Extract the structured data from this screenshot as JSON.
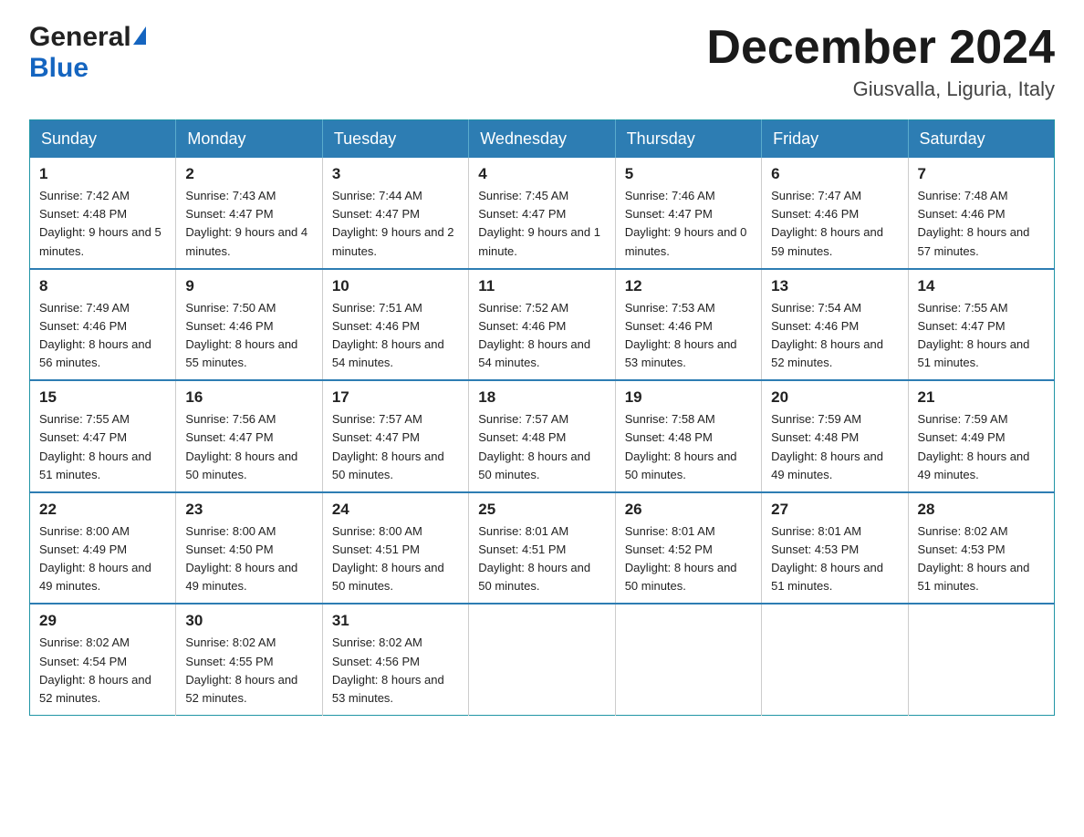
{
  "header": {
    "logo_general": "General",
    "logo_blue": "Blue",
    "month_title": "December 2024",
    "location": "Giusvalla, Liguria, Italy"
  },
  "days_of_week": [
    "Sunday",
    "Monday",
    "Tuesday",
    "Wednesday",
    "Thursday",
    "Friday",
    "Saturday"
  ],
  "weeks": [
    [
      {
        "day": "1",
        "sunrise": "7:42 AM",
        "sunset": "4:48 PM",
        "daylight": "9 hours and 5 minutes."
      },
      {
        "day": "2",
        "sunrise": "7:43 AM",
        "sunset": "4:47 PM",
        "daylight": "9 hours and 4 minutes."
      },
      {
        "day": "3",
        "sunrise": "7:44 AM",
        "sunset": "4:47 PM",
        "daylight": "9 hours and 2 minutes."
      },
      {
        "day": "4",
        "sunrise": "7:45 AM",
        "sunset": "4:47 PM",
        "daylight": "9 hours and 1 minute."
      },
      {
        "day": "5",
        "sunrise": "7:46 AM",
        "sunset": "4:47 PM",
        "daylight": "9 hours and 0 minutes."
      },
      {
        "day": "6",
        "sunrise": "7:47 AM",
        "sunset": "4:46 PM",
        "daylight": "8 hours and 59 minutes."
      },
      {
        "day": "7",
        "sunrise": "7:48 AM",
        "sunset": "4:46 PM",
        "daylight": "8 hours and 57 minutes."
      }
    ],
    [
      {
        "day": "8",
        "sunrise": "7:49 AM",
        "sunset": "4:46 PM",
        "daylight": "8 hours and 56 minutes."
      },
      {
        "day": "9",
        "sunrise": "7:50 AM",
        "sunset": "4:46 PM",
        "daylight": "8 hours and 55 minutes."
      },
      {
        "day": "10",
        "sunrise": "7:51 AM",
        "sunset": "4:46 PM",
        "daylight": "8 hours and 54 minutes."
      },
      {
        "day": "11",
        "sunrise": "7:52 AM",
        "sunset": "4:46 PM",
        "daylight": "8 hours and 54 minutes."
      },
      {
        "day": "12",
        "sunrise": "7:53 AM",
        "sunset": "4:46 PM",
        "daylight": "8 hours and 53 minutes."
      },
      {
        "day": "13",
        "sunrise": "7:54 AM",
        "sunset": "4:46 PM",
        "daylight": "8 hours and 52 minutes."
      },
      {
        "day": "14",
        "sunrise": "7:55 AM",
        "sunset": "4:47 PM",
        "daylight": "8 hours and 51 minutes."
      }
    ],
    [
      {
        "day": "15",
        "sunrise": "7:55 AM",
        "sunset": "4:47 PM",
        "daylight": "8 hours and 51 minutes."
      },
      {
        "day": "16",
        "sunrise": "7:56 AM",
        "sunset": "4:47 PM",
        "daylight": "8 hours and 50 minutes."
      },
      {
        "day": "17",
        "sunrise": "7:57 AM",
        "sunset": "4:47 PM",
        "daylight": "8 hours and 50 minutes."
      },
      {
        "day": "18",
        "sunrise": "7:57 AM",
        "sunset": "4:48 PM",
        "daylight": "8 hours and 50 minutes."
      },
      {
        "day": "19",
        "sunrise": "7:58 AM",
        "sunset": "4:48 PM",
        "daylight": "8 hours and 50 minutes."
      },
      {
        "day": "20",
        "sunrise": "7:59 AM",
        "sunset": "4:48 PM",
        "daylight": "8 hours and 49 minutes."
      },
      {
        "day": "21",
        "sunrise": "7:59 AM",
        "sunset": "4:49 PM",
        "daylight": "8 hours and 49 minutes."
      }
    ],
    [
      {
        "day": "22",
        "sunrise": "8:00 AM",
        "sunset": "4:49 PM",
        "daylight": "8 hours and 49 minutes."
      },
      {
        "day": "23",
        "sunrise": "8:00 AM",
        "sunset": "4:50 PM",
        "daylight": "8 hours and 49 minutes."
      },
      {
        "day": "24",
        "sunrise": "8:00 AM",
        "sunset": "4:51 PM",
        "daylight": "8 hours and 50 minutes."
      },
      {
        "day": "25",
        "sunrise": "8:01 AM",
        "sunset": "4:51 PM",
        "daylight": "8 hours and 50 minutes."
      },
      {
        "day": "26",
        "sunrise": "8:01 AM",
        "sunset": "4:52 PM",
        "daylight": "8 hours and 50 minutes."
      },
      {
        "day": "27",
        "sunrise": "8:01 AM",
        "sunset": "4:53 PM",
        "daylight": "8 hours and 51 minutes."
      },
      {
        "day": "28",
        "sunrise": "8:02 AM",
        "sunset": "4:53 PM",
        "daylight": "8 hours and 51 minutes."
      }
    ],
    [
      {
        "day": "29",
        "sunrise": "8:02 AM",
        "sunset": "4:54 PM",
        "daylight": "8 hours and 52 minutes."
      },
      {
        "day": "30",
        "sunrise": "8:02 AM",
        "sunset": "4:55 PM",
        "daylight": "8 hours and 52 minutes."
      },
      {
        "day": "31",
        "sunrise": "8:02 AM",
        "sunset": "4:56 PM",
        "daylight": "8 hours and 53 minutes."
      },
      null,
      null,
      null,
      null
    ]
  ],
  "labels": {
    "sunrise": "Sunrise:",
    "sunset": "Sunset:",
    "daylight": "Daylight:"
  }
}
